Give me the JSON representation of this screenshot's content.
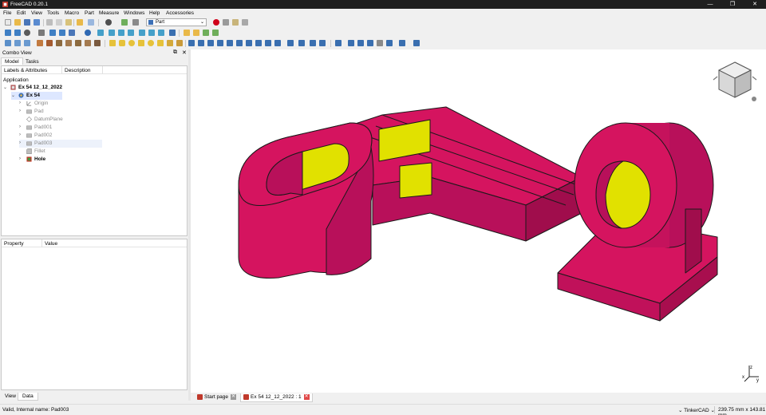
{
  "window": {
    "title": "FreeCAD 0.20.1",
    "min": "—",
    "max": "❐",
    "close": "✕"
  },
  "menu": [
    "File",
    "Edit",
    "View",
    "Tools",
    "Macro",
    "Part",
    "Measure",
    "Windows",
    "Help",
    "Accessories"
  ],
  "workbench": {
    "selected": "Part"
  },
  "combo": {
    "title": "Combo View",
    "float_btn": "⧉",
    "close_btn": "✕",
    "tabs": [
      "Model",
      "Tasks"
    ],
    "tree_headers": [
      "Labels & Attributes",
      "Description"
    ],
    "root": "Application",
    "items": [
      {
        "label": "Ex 54 12_12_2022",
        "arrow": "⌄"
      },
      {
        "label": "Ex 54",
        "arrow": "⌄"
      },
      {
        "label": "Origin",
        "arrow": "›"
      },
      {
        "label": "Pad",
        "arrow": "›"
      },
      {
        "label": "DatumPlane",
        "arrow": ""
      },
      {
        "label": "Pad001",
        "arrow": "›"
      },
      {
        "label": "Pad002",
        "arrow": "›"
      },
      {
        "label": "Pad003",
        "arrow": "›"
      },
      {
        "label": "Fillet",
        "arrow": ""
      },
      {
        "label": "Hole",
        "arrow": "›"
      }
    ]
  },
  "property": {
    "headers": [
      "Property",
      "Value"
    ],
    "tabs": [
      "View",
      "Data"
    ]
  },
  "doc_tabs": [
    {
      "label": "Start page",
      "close": "✕"
    },
    {
      "label": "Ex 54 12_12_2022 : 1",
      "close": "✕"
    }
  ],
  "status": {
    "message": "Valid, Internal name: Pad003",
    "nav": "⌄ TinkerCAD ⌄",
    "dims": "239.75 mm x 143.81 mm"
  },
  "axis": {
    "x": "x",
    "y": "y",
    "z": "z"
  },
  "colors": {
    "face": "#d5145f",
    "inner": "#e1e100",
    "edge": "#1a1a1a",
    "titlebar": "#1f1f1f",
    "record": "#d0021b"
  }
}
